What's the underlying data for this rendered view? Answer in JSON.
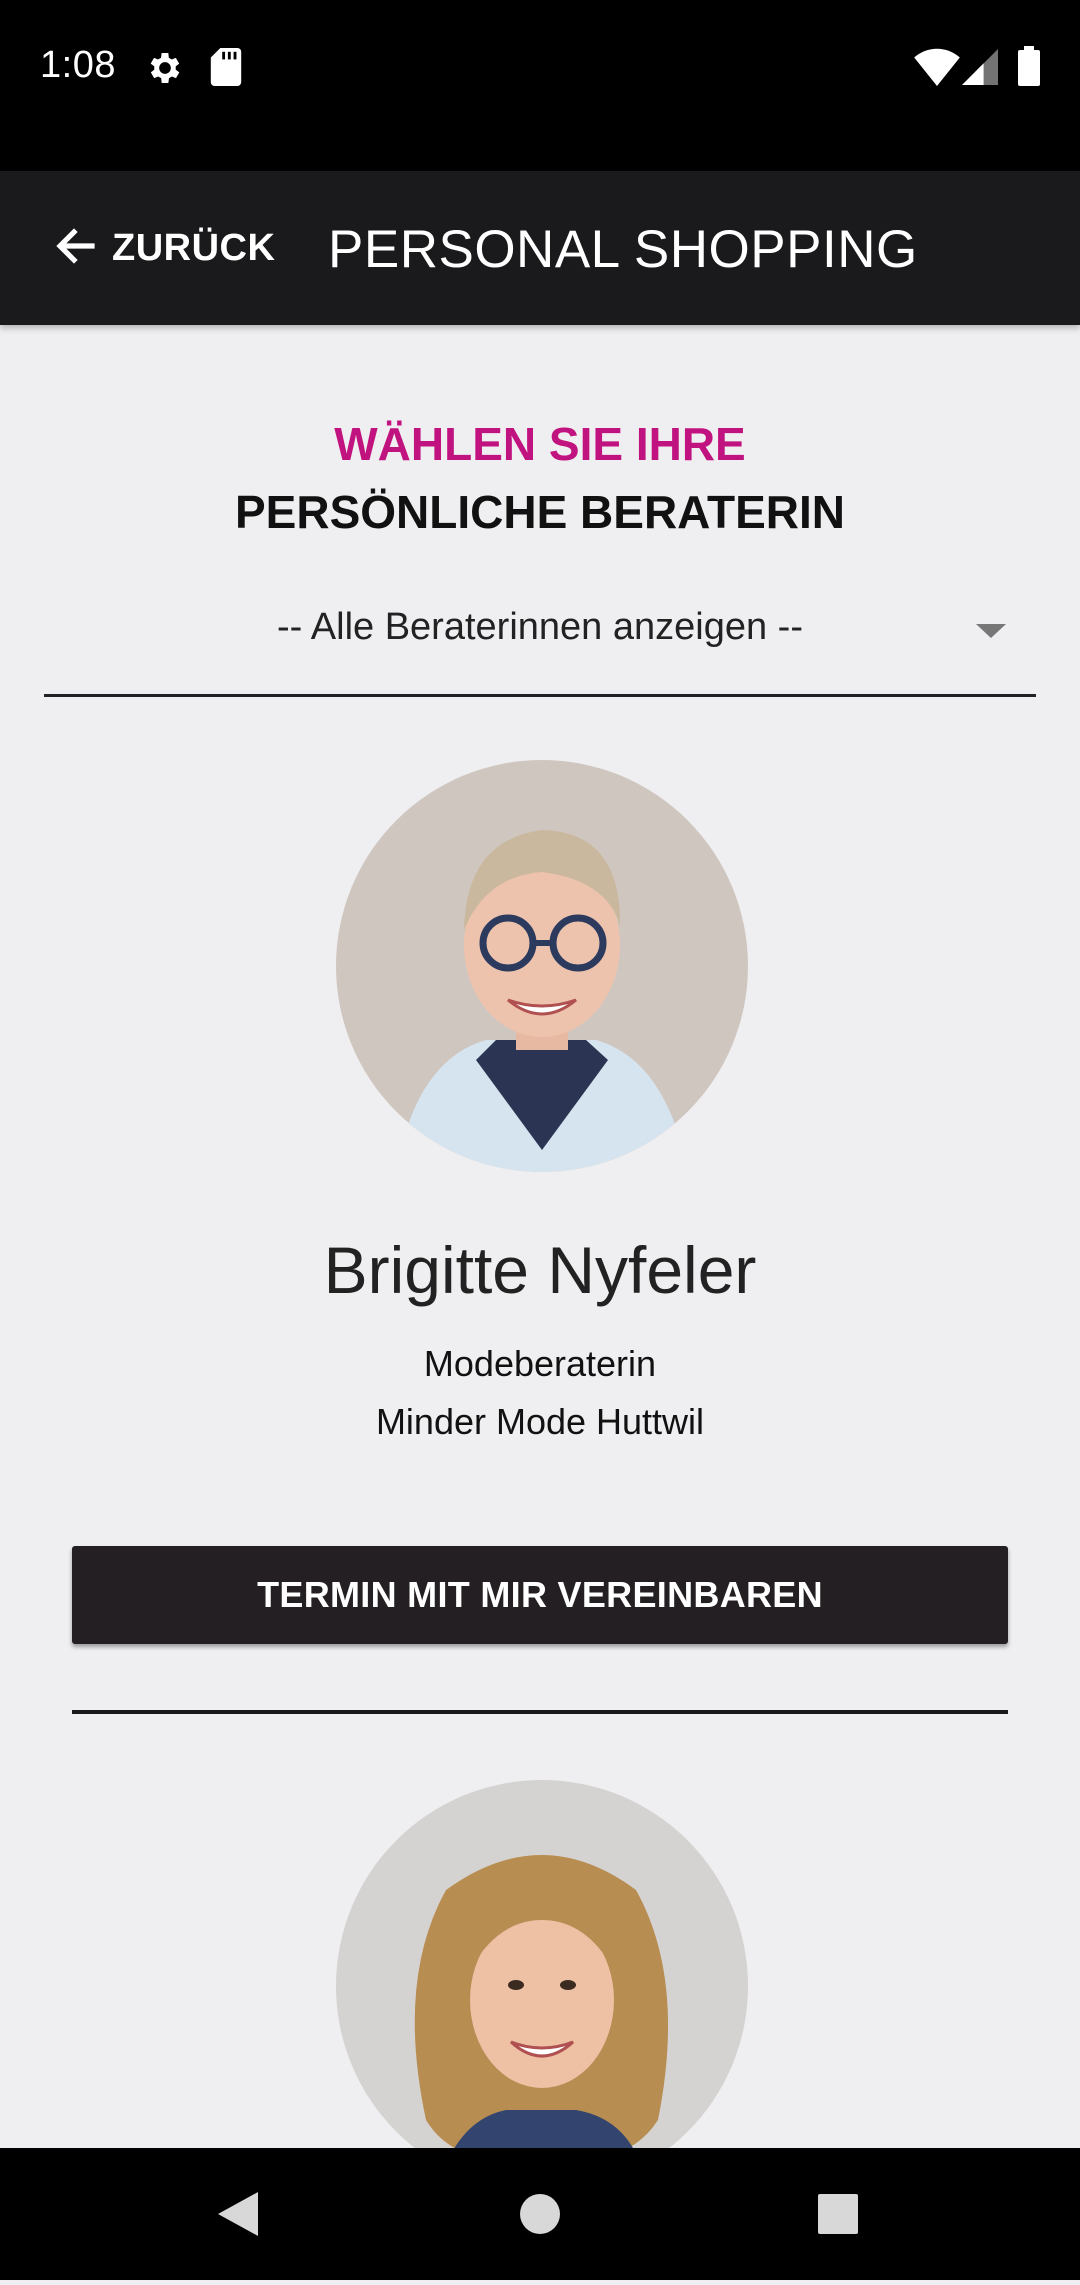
{
  "status_bar": {
    "time": "1:08",
    "icons": [
      "settings-icon",
      "sd-card-icon",
      "wifi-icon",
      "signal-icon",
      "battery-icon"
    ]
  },
  "app_bar": {
    "back_label": "ZURÜCK",
    "title": "PERSONAL SHOPPING"
  },
  "heading": {
    "line1": "WÄHLEN SIE IHRE",
    "line2": "PERSÖNLICHE BERATERIN"
  },
  "filter": {
    "selected": "-- Alle Beraterinnen anzeigen --"
  },
  "advisors": [
    {
      "name": "Brigitte Nyfeler",
      "role": "Modeberaterin",
      "store": "Minder Mode Huttwil",
      "button_label": "TERMIN MIT MIR VEREINBAREN"
    },
    {
      "name": "",
      "role": "",
      "store": "",
      "button_label": ""
    }
  ],
  "nav_bar": {
    "buttons": [
      "back-nav-icon",
      "home-nav-icon",
      "recents-nav-icon"
    ]
  },
  "colors": {
    "accent": "#c1137f",
    "app_bar": "#1a191b",
    "button": "#231f22",
    "background": "#efeef0"
  }
}
